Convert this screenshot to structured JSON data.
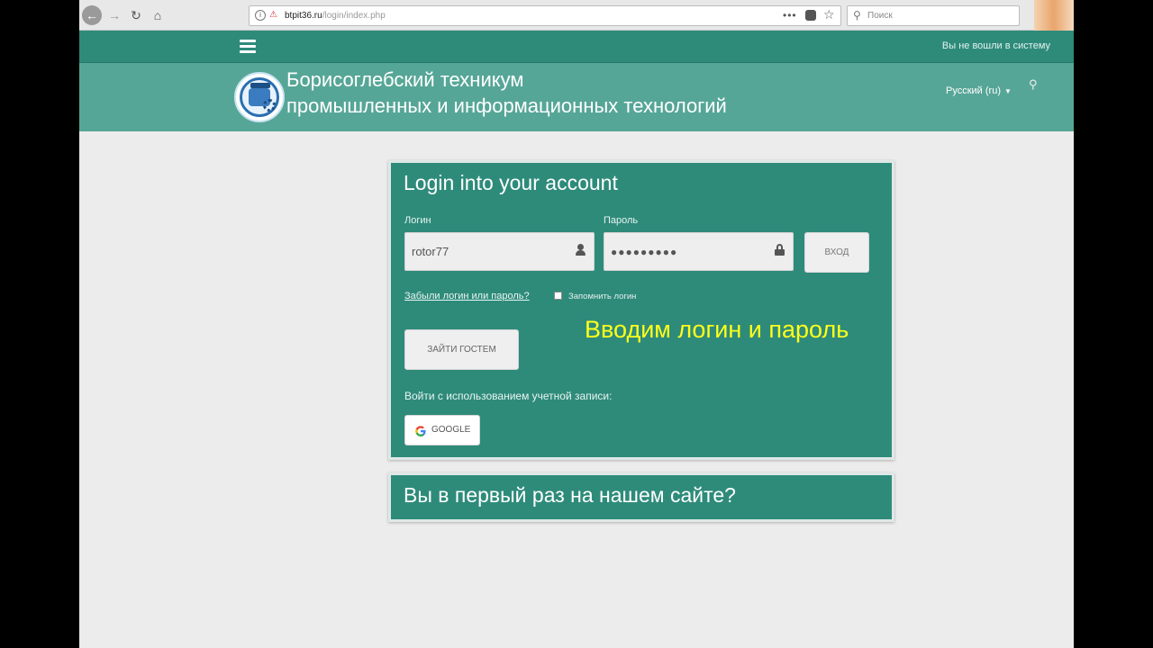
{
  "browser": {
    "url_host": "btpit36.ru",
    "url_path": "/login/index.php",
    "search_placeholder": "Поиск"
  },
  "header": {
    "login_status": "Вы не вошли в систему",
    "site_name_line1": "Борисоглебский техникум",
    "site_name_line2": "промышленных и информационных технологий",
    "language": "Русский (ru)"
  },
  "login": {
    "title": "Login into your account",
    "username_label": "Логин",
    "username_value": "rotor77",
    "password_label": "Пароль",
    "password_value": "●●●●●●●●●",
    "login_button": "вход",
    "forgot_link": "Забыли логин или пароль?",
    "remember_label": "Запомнить логин",
    "guest_button": "зайти гостем",
    "oauth_label": "Войти с использованием учетной записи:",
    "google_button": "Google",
    "overlay_note": "Вводим логин и пароль"
  },
  "signup": {
    "title": "Вы в первый раз на нашем сайте?"
  },
  "colors": {
    "primary": "#2e8b7a",
    "brand_bar": "#56a697",
    "overlay_note": "#ffff1a"
  }
}
